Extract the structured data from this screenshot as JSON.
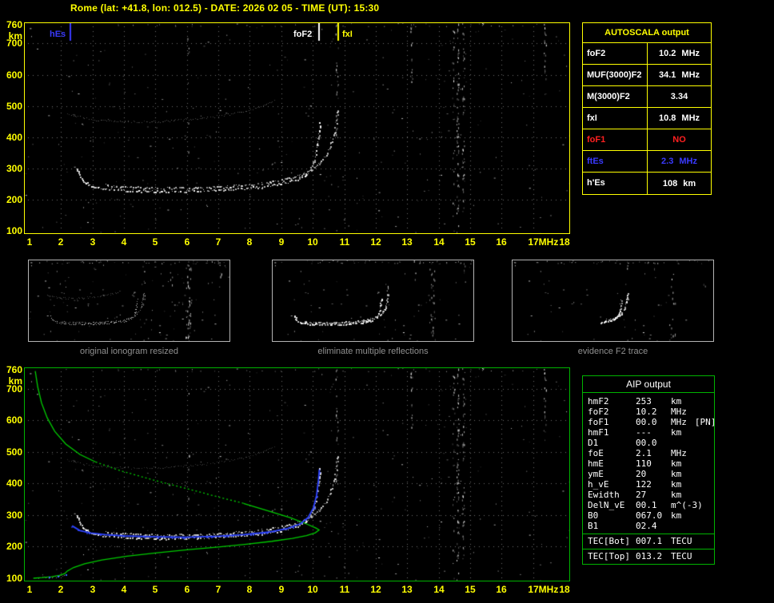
{
  "title": "Rome (lat: +41.8, lon: 012.5) - DATE: 2026 02 05 - TIME (UT): 15:30",
  "colors": {
    "yellow": "#ffff00",
    "green_border": "#00b400",
    "profile_green": "#00cc00",
    "blue": "#3a3aff",
    "red": "#ff2020",
    "trace_white": "#ffffff",
    "caption_gray": "#909090"
  },
  "autoscala": {
    "header": "AUTOSCALA output",
    "rows": [
      {
        "label": "foF2",
        "value": "10.2",
        "unit": "MHz",
        "color": "#ffffff"
      },
      {
        "label": "MUF(3000)F2",
        "value": "34.1",
        "unit": "MHz",
        "color": "#ffffff"
      },
      {
        "label": "M(3000)F2",
        "value": "3.34",
        "unit": "",
        "color": "#ffffff"
      },
      {
        "label": "fxI",
        "value": "10.8",
        "unit": "MHz",
        "color": "#ffffff"
      },
      {
        "label": "foF1",
        "value": "NO",
        "unit": "",
        "color": "#ff2020"
      },
      {
        "label": "ftEs",
        "value": "2.3",
        "unit": "MHz",
        "color": "#3a3aff"
      },
      {
        "label": "h'Es",
        "value": "108",
        "unit": "km",
        "color": "#ffffff"
      }
    ]
  },
  "thumbnails": [
    {
      "caption": "original ionogram resized"
    },
    {
      "caption": "eliminate multiple reflections"
    },
    {
      "caption": "evidence F2 trace"
    }
  ],
  "aip": {
    "header": "AIP output",
    "rows": [
      {
        "label": "hmF2",
        "value": "253",
        "unit": "km",
        "extra": ""
      },
      {
        "label": "foF2",
        "value": "10.2",
        "unit": "MHz",
        "extra": ""
      },
      {
        "label": "foF1",
        "value": "00.0",
        "unit": "MHz",
        "extra": "[PN]"
      },
      {
        "label": "hmF1",
        "value": "---",
        "unit": "km",
        "extra": ""
      },
      {
        "label": "D1",
        "value": "00.0",
        "unit": "",
        "extra": ""
      },
      {
        "label": "foE",
        "value": "2.1",
        "unit": "MHz",
        "extra": ""
      },
      {
        "label": "hmE",
        "value": "110",
        "unit": "km",
        "extra": ""
      },
      {
        "label": "ymE",
        "value": "20",
        "unit": "km",
        "extra": ""
      },
      {
        "label": "h_vE",
        "value": "122",
        "unit": "km",
        "extra": ""
      },
      {
        "label": "Ewidth",
        "value": "27",
        "unit": "km",
        "extra": ""
      },
      {
        "label": "DelN_vE",
        "value": "00.1",
        "unit": "m^(-3)",
        "extra": ""
      },
      {
        "label": "B0",
        "value": "067.0",
        "unit": "km",
        "extra": ""
      },
      {
        "label": "B1",
        "value": "02.4",
        "unit": "",
        "extra": ""
      }
    ],
    "tec_rows": [
      {
        "label": "TEC[Bot]",
        "value": "007.1",
        "unit": "TECU"
      },
      {
        "label": "TEC[Top]",
        "value": "013.2",
        "unit": "TECU"
      }
    ]
  },
  "chart_data": [
    {
      "id": "ionogram_autoscala",
      "type": "scatter",
      "title": "",
      "xlabel": "MHz",
      "ylabel": "km",
      "xlim": [
        1,
        18
      ],
      "ylim": [
        100,
        760
      ],
      "x_ticks": [
        1,
        2,
        3,
        4,
        5,
        6,
        7,
        8,
        9,
        10,
        11,
        12,
        13,
        14,
        15,
        16,
        17,
        18
      ],
      "y_ticks": [
        760,
        700,
        600,
        500,
        400,
        300,
        200,
        100
      ],
      "grid": true,
      "markers": [
        {
          "label": "hEs",
          "freq_mhz": 2.3,
          "color": "#3a3aff",
          "label_side": "left"
        },
        {
          "label": "foF2",
          "freq_mhz": 10.2,
          "color": "#ffffff",
          "label_side": "left"
        },
        {
          "label": "fxI",
          "freq_mhz": 10.8,
          "color": "#ffff00",
          "label_side": "right"
        }
      ],
      "traces": [
        {
          "name": "F2-ordinary",
          "color": "#ffffff",
          "intensity": 1.0,
          "size": 2,
          "points": [
            [
              2.5,
              300
            ],
            [
              2.62,
              272
            ],
            [
              2.78,
              254
            ],
            [
              3.0,
              244
            ],
            [
              3.4,
              236
            ],
            [
              4.0,
              231
            ],
            [
              4.8,
              228
            ],
            [
              5.8,
              227
            ],
            [
              6.8,
              230
            ],
            [
              7.6,
              234
            ],
            [
              8.4,
              242
            ],
            [
              9.0,
              252
            ],
            [
              9.5,
              266
            ],
            [
              9.8,
              284
            ],
            [
              10.0,
              312
            ],
            [
              10.1,
              350
            ],
            [
              10.17,
              400
            ],
            [
              10.22,
              455
            ]
          ]
        },
        {
          "name": "F2-extraordinary",
          "color": "#ffffff",
          "intensity": 0.8,
          "size": 2,
          "points": [
            [
              3.4,
              247
            ],
            [
              4.0,
              242
            ],
            [
              5.0,
              238
            ],
            [
              6.0,
              238
            ],
            [
              7.0,
              241
            ],
            [
              7.8,
              247
            ],
            [
              8.6,
              256
            ],
            [
              9.2,
              268
            ],
            [
              9.7,
              284
            ],
            [
              10.1,
              308
            ],
            [
              10.4,
              340
            ],
            [
              10.6,
              385
            ],
            [
              10.73,
              440
            ],
            [
              10.8,
              505
            ]
          ]
        },
        {
          "name": "second-reflection",
          "color": "#cccccc",
          "intensity": 0.45,
          "size": 1,
          "points": [
            [
              2.2,
              476
            ],
            [
              2.7,
              462
            ],
            [
              3.3,
              454
            ],
            [
              4.2,
              450
            ],
            [
              5.2,
              452
            ],
            [
              6.2,
              458
            ],
            [
              7.0,
              468
            ],
            [
              7.8,
              482
            ],
            [
              8.4,
              500
            ],
            [
              8.8,
              520
            ]
          ]
        }
      ]
    },
    {
      "id": "ionogram_profile",
      "type": "scatter",
      "title": "",
      "xlabel": "MHz",
      "ylabel": "km",
      "xlim": [
        1,
        18
      ],
      "ylim": [
        100,
        760
      ],
      "x_ticks": [
        1,
        2,
        3,
        4,
        5,
        6,
        7,
        8,
        9,
        10,
        11,
        12,
        13,
        14,
        15,
        16,
        17,
        18
      ],
      "y_ticks": [
        760,
        700,
        600,
        500,
        400,
        300,
        200,
        100
      ],
      "grid": true,
      "traces": [
        {
          "name": "F2-ordinary",
          "color": "#ffffff",
          "intensity": 1.0,
          "size": 2,
          "points": [
            [
              2.5,
              300
            ],
            [
              2.62,
              272
            ],
            [
              2.78,
              254
            ],
            [
              3.0,
              244
            ],
            [
              3.4,
              236
            ],
            [
              4.0,
              231
            ],
            [
              4.8,
              228
            ],
            [
              5.8,
              227
            ],
            [
              6.8,
              230
            ],
            [
              7.6,
              234
            ],
            [
              8.4,
              242
            ],
            [
              9.0,
              252
            ],
            [
              9.5,
              266
            ],
            [
              9.8,
              284
            ],
            [
              10.0,
              312
            ],
            [
              10.1,
              350
            ],
            [
              10.17,
              400
            ],
            [
              10.22,
              455
            ]
          ]
        },
        {
          "name": "F2-extraordinary",
          "color": "#ffffff",
          "intensity": 0.8,
          "size": 2,
          "points": [
            [
              3.4,
              247
            ],
            [
              4.0,
              242
            ],
            [
              5.0,
              238
            ],
            [
              6.0,
              238
            ],
            [
              7.0,
              241
            ],
            [
              7.8,
              247
            ],
            [
              8.6,
              256
            ],
            [
              9.2,
              268
            ],
            [
              9.7,
              284
            ],
            [
              10.1,
              308
            ],
            [
              10.4,
              340
            ],
            [
              10.6,
              385
            ],
            [
              10.73,
              440
            ],
            [
              10.8,
              505
            ]
          ]
        },
        {
          "name": "second-reflection",
          "color": "#cccccc",
          "intensity": 0.35,
          "size": 1,
          "points": [
            [
              2.2,
              476
            ],
            [
              2.7,
              462
            ],
            [
              3.3,
              454
            ],
            [
              4.2,
              450
            ],
            [
              5.2,
              452
            ],
            [
              6.2,
              458
            ],
            [
              7.0,
              468
            ],
            [
              7.8,
              482
            ],
            [
              8.4,
              500
            ],
            [
              8.8,
              520
            ]
          ]
        },
        {
          "name": "Es-trace",
          "color": "#ffffff",
          "intensity": 0.6,
          "size": 1,
          "points": [
            [
              1.25,
              101
            ],
            [
              1.6,
              103
            ],
            [
              1.95,
              106
            ],
            [
              2.2,
              110
            ]
          ]
        }
      ],
      "profile": {
        "color": "#00cc00",
        "segments": [
          {
            "style": "solid",
            "points": [
              [
                1.18,
                756
              ],
              [
                1.26,
                705
              ],
              [
                1.38,
                655
              ],
              [
                1.56,
                608
              ],
              [
                1.8,
                565
              ],
              [
                2.15,
                525
              ],
              [
                2.6,
                492
              ],
              [
                3.1,
                468
              ]
            ]
          },
          {
            "style": "dotted",
            "points": [
              [
                3.1,
                468
              ],
              [
                3.9,
                440
              ],
              [
                4.9,
                412
              ],
              [
                5.9,
                386
              ],
              [
                6.9,
                360
              ],
              [
                7.8,
                337
              ]
            ]
          },
          {
            "style": "solid",
            "points": [
              [
                7.8,
                337
              ],
              [
                8.6,
                313
              ],
              [
                9.3,
                291
              ],
              [
                9.8,
                272
              ],
              [
                10.1,
                259
              ],
              [
                10.2,
                253
              ],
              [
                10.08,
                244
              ],
              [
                9.8,
                235
              ],
              [
                9.35,
                226
              ],
              [
                8.7,
                217
              ],
              [
                7.9,
                208
              ],
              [
                7.0,
                199
              ],
              [
                6.0,
                190
              ],
              [
                5.0,
                180
              ],
              [
                4.1,
                170
              ],
              [
                3.3,
                158
              ],
              [
                2.75,
                146
              ],
              [
                2.4,
                134
              ],
              [
                2.2,
                123
              ],
              [
                2.12,
                115
              ],
              [
                1.95,
                109
              ],
              [
                1.7,
                105
              ],
              [
                1.4,
                102
              ],
              [
                1.12,
                100
              ]
            ]
          }
        ]
      },
      "scaled_trace": {
        "color": "#2e44ff",
        "points": [
          [
            2.35,
            266
          ],
          [
            2.6,
            251
          ],
          [
            2.95,
            243
          ],
          [
            3.4,
            238
          ],
          [
            4.0,
            234
          ],
          [
            5.0,
            231
          ],
          [
            6.0,
            230
          ],
          [
            7.0,
            233
          ],
          [
            7.8,
            238
          ],
          [
            8.6,
            246
          ],
          [
            9.2,
            258
          ],
          [
            9.6,
            272
          ],
          [
            9.85,
            292
          ],
          [
            10.02,
            322
          ],
          [
            10.12,
            362
          ],
          [
            10.18,
            410
          ],
          [
            10.21,
            445
          ]
        ]
      },
      "es_marks": {
        "color": "#3a6aff",
        "points": [
          [
            1.6,
            106
          ],
          [
            1.9,
            108
          ],
          [
            2.15,
            112
          ]
        ]
      }
    }
  ]
}
